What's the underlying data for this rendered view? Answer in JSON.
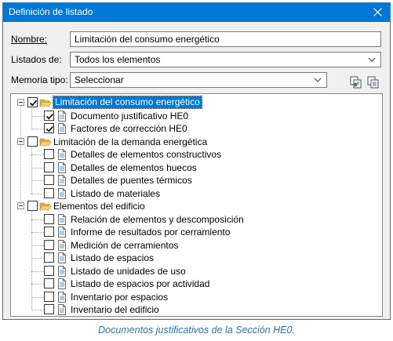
{
  "window": {
    "title": "Definición de listado"
  },
  "form": {
    "nombre_label": "Nombre:",
    "nombre_value": "Limitación del consumo energético",
    "listados_label": "Listados de:",
    "listados_value": "Todos los elementos",
    "memoria_label": "Memoria tipo:",
    "memoria_value": "Seleccionar"
  },
  "tree": {
    "groups": [
      {
        "label": "Limitación del consumo energético",
        "checked": true,
        "selected": true,
        "items": [
          {
            "label": "Documento justificativo HE0",
            "checked": true
          },
          {
            "label": "Factores de corrección HE0",
            "checked": true
          }
        ]
      },
      {
        "label": "Limitación de la demanda energética",
        "checked": false,
        "items": [
          {
            "label": "Detalles de elementos constructivos",
            "checked": false
          },
          {
            "label": "Detalles de elementos huecos",
            "checked": false
          },
          {
            "label": "Detalles de puentes térmicos",
            "checked": false
          },
          {
            "label": "Listado de materiales",
            "checked": false
          }
        ]
      },
      {
        "label": "Elementos del edificio",
        "checked": false,
        "items": [
          {
            "label": "Relación de elementos y descomposición",
            "checked": false
          },
          {
            "label": "Informe de resultados por cerramiento",
            "checked": false
          },
          {
            "label": "Medición de cerramientos",
            "checked": false
          },
          {
            "label": "Listado de espacios",
            "checked": false
          },
          {
            "label": "Listado de unidades de uso",
            "checked": false
          },
          {
            "label": "Listado de espacios por actividad",
            "checked": false
          },
          {
            "label": "Inventario por espacios",
            "checked": false
          },
          {
            "label": "Inventario del edificio",
            "checked": false
          }
        ]
      }
    ]
  },
  "caption": "Documentos justificativos de la Sección HE0.",
  "colors": {
    "accent": "#0078d7",
    "caption": "#2e75b6",
    "folder": "#e8b84a"
  },
  "icons": {
    "close": "close-icon",
    "folder": "folder-open-icon",
    "doc": "document-icon",
    "copy": "copy-icon",
    "paste": "paste-icon",
    "dropdown": "chevron-down-icon"
  }
}
